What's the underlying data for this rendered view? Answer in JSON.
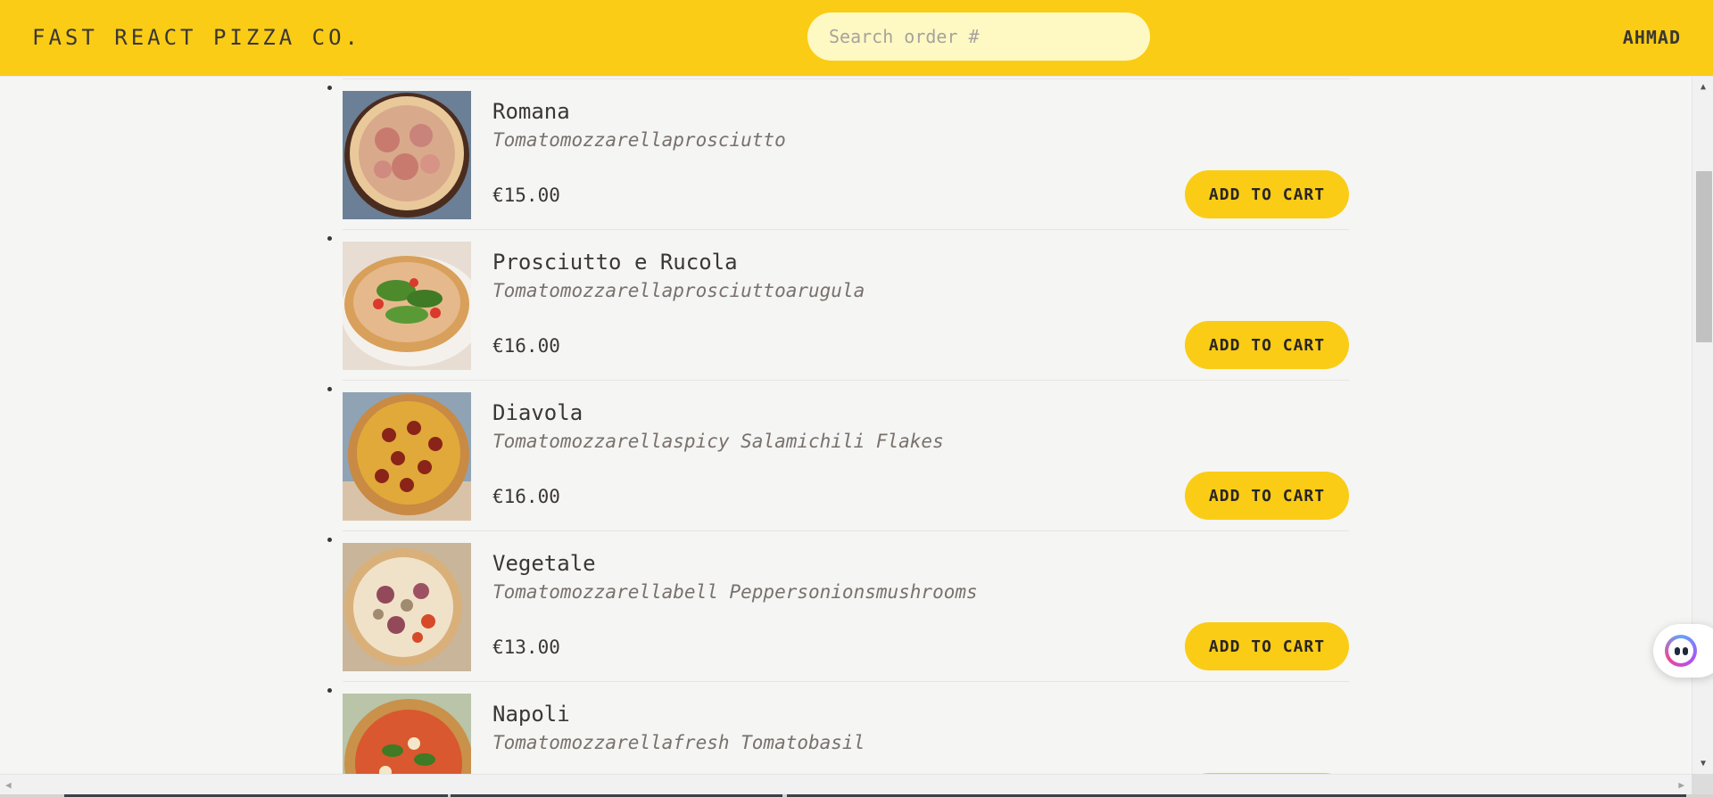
{
  "header": {
    "brand": "Fast React Pizza Co.",
    "search_placeholder": "Search order #",
    "user_name": "ahmad"
  },
  "menu": {
    "button_label": "Add to cart",
    "items": [
      {
        "name": "Romana",
        "ingredients": "Tomatomozzarellaprosciutto",
        "price": "€15.00",
        "image": "pizza-romana-image"
      },
      {
        "name": "Prosciutto e Rucola",
        "ingredients": "Tomatomozzarellaprosciuttoarugula",
        "price": "€16.00",
        "image": "pizza-prosciutto-rucola-image"
      },
      {
        "name": "Diavola",
        "ingredients": "Tomatomozzarellaspicy Salamichili Flakes",
        "price": "€16.00",
        "image": "pizza-diavola-image"
      },
      {
        "name": "Vegetale",
        "ingredients": "Tomatomozzarellabell Peppersonionsmushrooms",
        "price": "€13.00",
        "image": "pizza-vegetale-image"
      },
      {
        "name": "Napoli",
        "ingredients": "Tomatomozzarellafresh Tomatobasil",
        "price": "",
        "image": "pizza-napoli-image"
      }
    ]
  },
  "colors": {
    "header_bg": "#facc15",
    "page_bg": "#f5f5f4",
    "search_bg": "#fef9c3",
    "button_bg": "#facc15",
    "text": "#3a3734",
    "muted_text": "#78716c"
  },
  "icons": {
    "scroll_up": "triangle-up-icon",
    "scroll_down": "triangle-down-icon",
    "scroll_left": "triangle-left-icon",
    "scroll_right": "triangle-right-icon",
    "assistant": "assistant-orb-icon"
  }
}
